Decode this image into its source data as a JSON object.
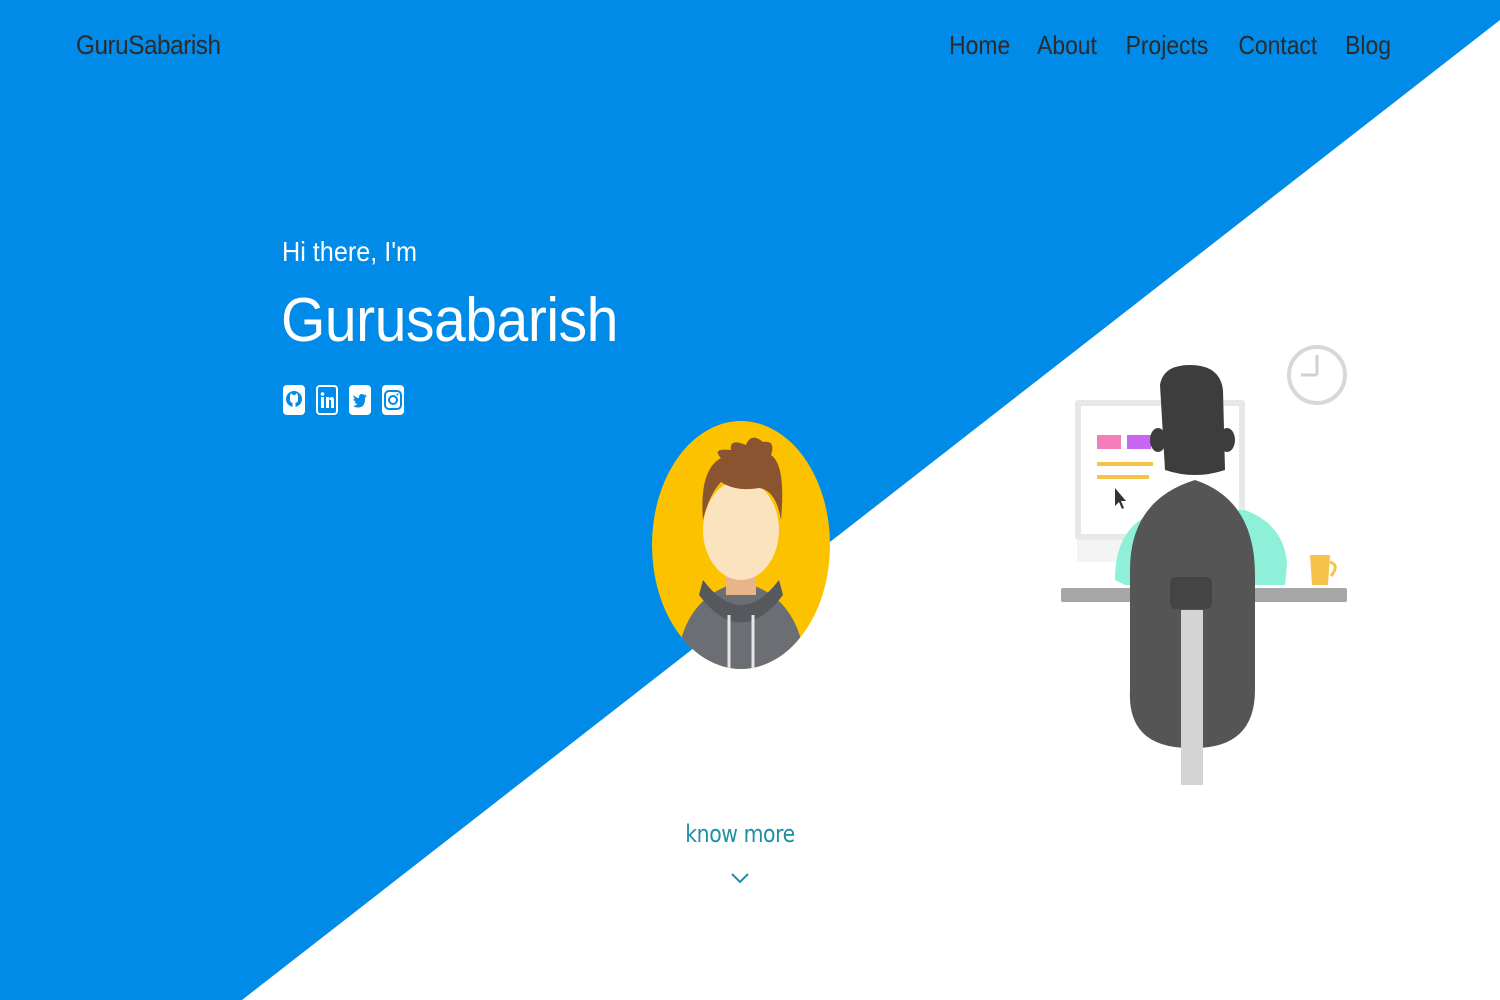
{
  "colors": {
    "hero_blue": "#008be8",
    "background": "#ffffff",
    "nav_text": "#2b2b2b",
    "accent_teal": "#1f8fa6",
    "avatar_yellow": "#fcc200"
  },
  "nav": {
    "brand": "GuruSabarish",
    "links": [
      {
        "label": "Home"
      },
      {
        "label": "About"
      },
      {
        "label": "Projects"
      },
      {
        "label": "Contact"
      },
      {
        "label": "Blog"
      }
    ]
  },
  "hero": {
    "greeting": "Hi there, I'm",
    "name": "Gurusabarish",
    "socials": [
      {
        "icon": "github-icon"
      },
      {
        "icon": "linkedin-icon"
      },
      {
        "icon": "twitter-icon"
      },
      {
        "icon": "instagram-icon"
      }
    ]
  },
  "cta": {
    "label": "know more",
    "icon": "chevron-down-icon"
  }
}
